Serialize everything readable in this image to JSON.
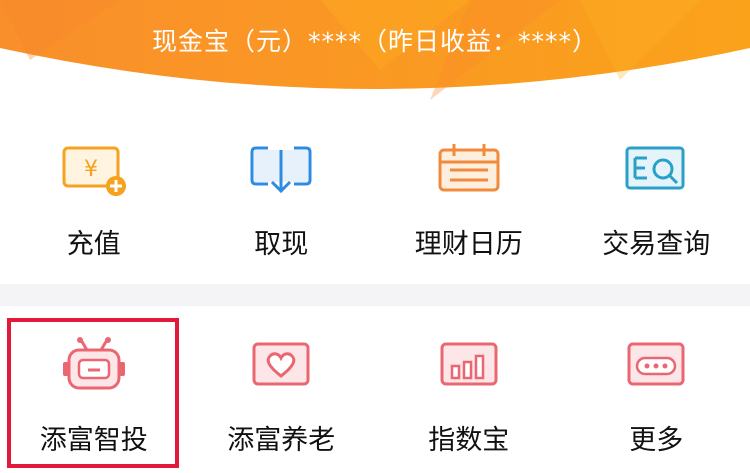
{
  "banner": {
    "text": "现金宝（元）****（昨日收益：****）",
    "colors": {
      "start": "#f9902a",
      "end": "#fba21a"
    }
  },
  "actions_row1": [
    {
      "label": "充值",
      "icon": "recharge-icon"
    },
    {
      "label": "取现",
      "icon": "withdraw-icon"
    },
    {
      "label": "理财日历",
      "icon": "calendar-icon"
    },
    {
      "label": "交易查询",
      "icon": "transaction-query-icon"
    }
  ],
  "actions_row2": [
    {
      "label": "添富智投",
      "icon": "robot-icon"
    },
    {
      "label": "添富养老",
      "icon": "heart-card-icon"
    },
    {
      "label": "指数宝",
      "icon": "bar-chart-icon"
    },
    {
      "label": "更多",
      "icon": "more-icon"
    }
  ],
  "colors": {
    "icon_orange": "#f6a11f",
    "icon_blue": "#2e8be0",
    "icon_red": "#ea6772",
    "highlight": "#e0193d"
  }
}
